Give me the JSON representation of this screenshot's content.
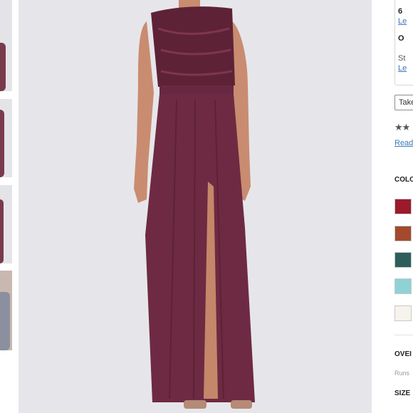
{
  "info_panel": {
    "line1": "6",
    "line1_link": "Le",
    "line2": "O",
    "line3": "St",
    "line3_link": "Le",
    "select_value": "Take",
    "rating_stars": "★★",
    "read_reviews_link": "Read",
    "color_heading": "COLO",
    "swatches": [
      "#9b1b2c",
      "#a34a2e",
      "#2d5e5a",
      "#8fd2d6",
      "#f6f3ec"
    ],
    "overview_heading": "OVEI",
    "overview_text": "Runs",
    "size_heading": "SIZE"
  },
  "colors": {
    "dress": "#6e2a42",
    "background": "#e6e6ea",
    "skin": "#c98c70"
  }
}
